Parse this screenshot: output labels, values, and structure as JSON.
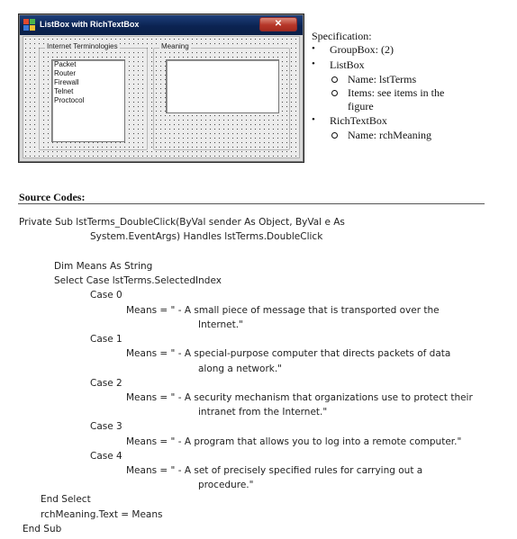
{
  "window": {
    "title": "ListBox with RichTextBox",
    "close_glyph": "✕",
    "group1_label": "Internet Terminologies",
    "group2_label": "Meaning",
    "list_items": [
      "Packet",
      "Router",
      "Firewall",
      "Telnet",
      "Proctocol"
    ]
  },
  "spec": {
    "title": "Specification:",
    "bullets": [
      {
        "text": "GroupBox: (2)",
        "subs": []
      },
      {
        "text": "ListBox",
        "subs": [
          "Name: lstTerms",
          "Items: see items in the",
          "figure"
        ]
      },
      {
        "text": "RichTextBox",
        "subs": [
          "Name: rchMeaning"
        ]
      }
    ]
  },
  "source": {
    "heading": "Source Codes:",
    "lines": [
      "Private Sub lstTerms_DoubleClick(ByVal sender As Object, ByVal e As",
      "System.EventArgs) Handles lstTerms.DoubleClick",
      "Dim Means As String",
      "Select Case lstTerms.SelectedIndex",
      "Case 0",
      "Means = \" - A small piece of message that is transported over the",
      "Internet.\"",
      "Case 1",
      "Means = \" - A special-purpose computer that directs packets of data",
      "along a network.\"",
      "Case 2",
      "Means = \" - A security mechanism that organizations use to protect their",
      "intranet from the Internet.\"",
      "Case 3",
      "Means = \" - A program that allows you to log into a remote computer.\"",
      "Case 4",
      "Means = \" - A set of precisely specified rules for carrying out a",
      "procedure.\"",
      "End Select",
      "rchMeaning.Text = Means",
      "End Sub"
    ]
  }
}
